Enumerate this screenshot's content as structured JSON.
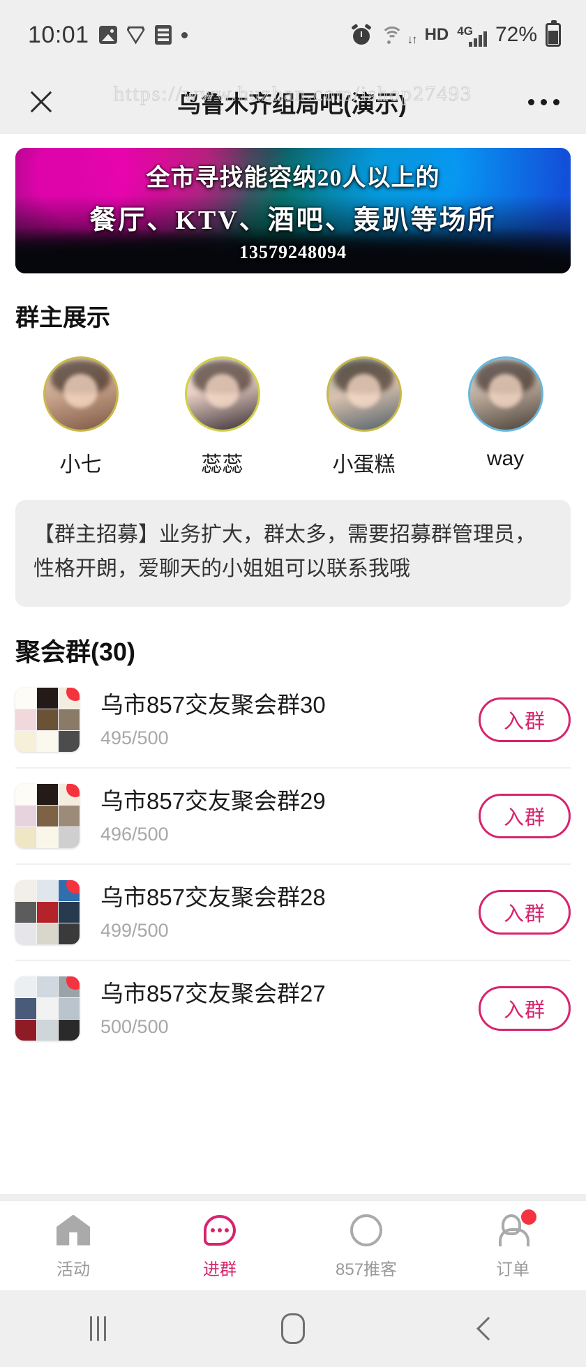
{
  "status_bar": {
    "time": "10:01",
    "left_icons": [
      "photo-icon",
      "shield-icon",
      "list-icon",
      "dot-icon"
    ],
    "alarm_icon": "alarm-icon",
    "wifi_icon": "wifi-icon",
    "hd_label": "HD",
    "network_label": "4G",
    "signal_icon": "signal-icon",
    "battery_percent": "72%",
    "battery_icon": "battery-icon"
  },
  "watermark": "https://www.huzhan.com/ishop27493",
  "header": {
    "close_icon": "close-icon",
    "title": "乌鲁木齐组局吧(演示)",
    "more_icon": "more-options-icon"
  },
  "banner": {
    "line1": "全市寻找能容纳20人以上的",
    "line2": "餐厅、KTV、酒吧、轰趴等场所",
    "phone": "13579248094"
  },
  "owners_section": {
    "title": "群主展示",
    "owners": [
      {
        "name": "小七",
        "ring": "#c9b84a"
      },
      {
        "name": "蕊蕊",
        "ring": "#cfd14a"
      },
      {
        "name": "小蛋糕",
        "ring": "#c9b84a"
      },
      {
        "name": "way",
        "ring": "#67b8dc"
      }
    ]
  },
  "notice": "【群主招募】业务扩大，群太多，需要招募群管理员，性格开朗，爱聊天的小姐姐可以联系我哦",
  "groups_section": {
    "title": "聚会群(30)",
    "join_label": "入群",
    "rows": [
      {
        "name": "乌市857交友聚会群30",
        "count": "495/500",
        "join": "入群"
      },
      {
        "name": "乌市857交友聚会群29",
        "count": "496/500",
        "join": "入群"
      },
      {
        "name": "乌市857交友聚会群28",
        "count": "499/500",
        "join": "入群"
      },
      {
        "name": "乌市857交友聚会群27",
        "count": "500/500",
        "join": "入群"
      }
    ]
  },
  "tabbar": {
    "tabs": [
      {
        "label": "活动",
        "icon": "home-icon",
        "active": false,
        "badge": false
      },
      {
        "label": "进群",
        "icon": "chat-icon",
        "active": true,
        "badge": false
      },
      {
        "label": "857推客",
        "icon": "compass-icon",
        "active": false,
        "badge": false
      },
      {
        "label": "订单",
        "icon": "user-icon",
        "active": false,
        "badge": true
      }
    ],
    "accent_color": "#d6246e",
    "inactive_color": "#9a9a9a"
  },
  "nav_bar": {
    "recent_icon": "recent-apps-icon",
    "home_icon": "home-button-icon",
    "back_icon": "back-button-icon"
  }
}
